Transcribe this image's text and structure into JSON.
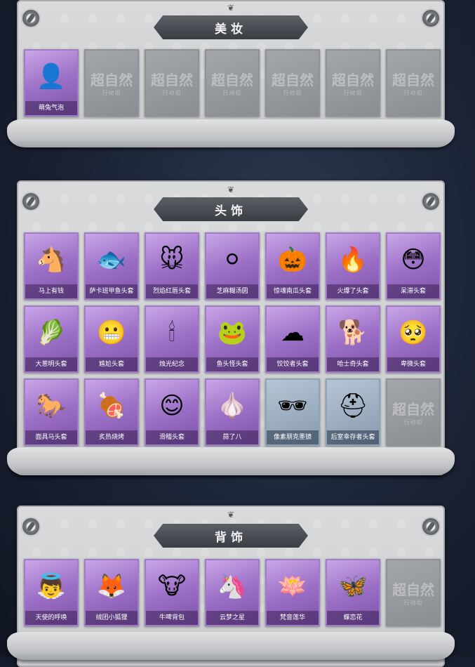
{
  "sections": [
    {
      "title": "美妆",
      "items": [
        {
          "label": "萌兔气泡",
          "icon": "bunny-bubble-icon",
          "glyph": "👤",
          "style": "purple"
        },
        {
          "label": "",
          "icon": "empty-slot-icon",
          "glyph": "",
          "style": "empty"
        },
        {
          "label": "",
          "icon": "empty-slot-icon",
          "glyph": "",
          "style": "empty"
        },
        {
          "label": "",
          "icon": "empty-slot-icon",
          "glyph": "",
          "style": "empty"
        },
        {
          "label": "",
          "icon": "empty-slot-icon",
          "glyph": "",
          "style": "empty"
        },
        {
          "label": "",
          "icon": "empty-slot-icon",
          "glyph": "",
          "style": "empty"
        },
        {
          "label": "",
          "icon": "empty-slot-icon",
          "glyph": "",
          "style": "empty"
        }
      ]
    },
    {
      "title": "头饰",
      "items": [
        {
          "label": "马上有钱",
          "icon": "red-horse-head-icon",
          "glyph": "🐴",
          "style": "purple"
        },
        {
          "label": "萨卡班甲鱼头套",
          "icon": "fish-head-icon",
          "glyph": "🐟",
          "style": "purple"
        },
        {
          "label": "烈焰红唇头套",
          "icon": "pikachu-lips-icon",
          "glyph": "🐭",
          "style": "purple"
        },
        {
          "label": "芝麻糊汤圆",
          "icon": "dumpling-head-icon",
          "glyph": "⚪",
          "style": "purple"
        },
        {
          "label": "惊魂南瓜头套",
          "icon": "pumpkin-head-icon",
          "glyph": "🎃",
          "style": "purple"
        },
        {
          "label": "火爆了头套",
          "icon": "fire-head-icon",
          "glyph": "🔥",
          "style": "purple"
        },
        {
          "label": "呆滞头套",
          "icon": "dazed-emoji-icon",
          "glyph": "😳",
          "style": "purple"
        },
        {
          "label": "大葱明头套",
          "icon": "scallion-head-icon",
          "glyph": "🥬",
          "style": "purple"
        },
        {
          "label": "尴尬头套",
          "icon": "grimace-emoji-icon",
          "glyph": "😬",
          "style": "purple"
        },
        {
          "label": "烛光纪念",
          "icon": "candle-head-icon",
          "glyph": "🕯",
          "style": "purple"
        },
        {
          "label": "鱼头怪头套",
          "icon": "fish-monster-icon",
          "glyph": "🐸",
          "style": "purple"
        },
        {
          "label": "饺饺者头套",
          "icon": "cloud-dumpling-icon",
          "glyph": "☁",
          "style": "purple"
        },
        {
          "label": "哈士奇头套",
          "icon": "husky-head-icon",
          "glyph": "🐕",
          "style": "purple"
        },
        {
          "label": "卑微头套",
          "icon": "pleading-emoji-icon",
          "glyph": "🥺",
          "style": "purple"
        },
        {
          "label": "面具马头套",
          "icon": "horse-mask-icon",
          "glyph": "🐎",
          "style": "purple"
        },
        {
          "label": "炙热烧烤",
          "icon": "grilled-meat-icon",
          "glyph": "🍖",
          "style": "purple"
        },
        {
          "label": "滑稽头套",
          "icon": "silly-emoji-icon",
          "glyph": "😊",
          "style": "purple"
        },
        {
          "label": "蒜了八",
          "icon": "garlic-head-icon",
          "glyph": "🧄",
          "style": "purple"
        },
        {
          "label": "像素朋克墨镜",
          "icon": "pixel-sunglasses-icon",
          "glyph": "🕶",
          "style": "blue"
        },
        {
          "label": "后室幸存者头套",
          "icon": "gas-mask-icon",
          "glyph": "⛑",
          "style": "blue"
        },
        {
          "label": "",
          "icon": "empty-slot-icon",
          "glyph": "",
          "style": "empty"
        }
      ]
    },
    {
      "title": "背饰",
      "items": [
        {
          "label": "天使的呼唤",
          "icon": "angel-doll-icon",
          "glyph": "👼",
          "style": "purple"
        },
        {
          "label": "绒团小狐狸",
          "icon": "fox-plush-icon",
          "glyph": "🦊",
          "style": "purple"
        },
        {
          "label": "牛啤背包",
          "icon": "cow-barrel-icon",
          "glyph": "🐮",
          "style": "purple"
        },
        {
          "label": "云梦之星",
          "icon": "unicorn-star-icon",
          "glyph": "🦄",
          "style": "purple"
        },
        {
          "label": "梵音莲华",
          "icon": "lotus-doll-icon",
          "glyph": "🪷",
          "style": "purple"
        },
        {
          "label": "蝶恋花",
          "icon": "butterfly-flower-icon",
          "glyph": "🦋",
          "style": "purple"
        },
        {
          "label": "",
          "icon": "empty-slot-icon",
          "glyph": "",
          "style": "empty"
        }
      ]
    }
  ],
  "watermark": {
    "main": "超自然",
    "sub": "行动组"
  }
}
